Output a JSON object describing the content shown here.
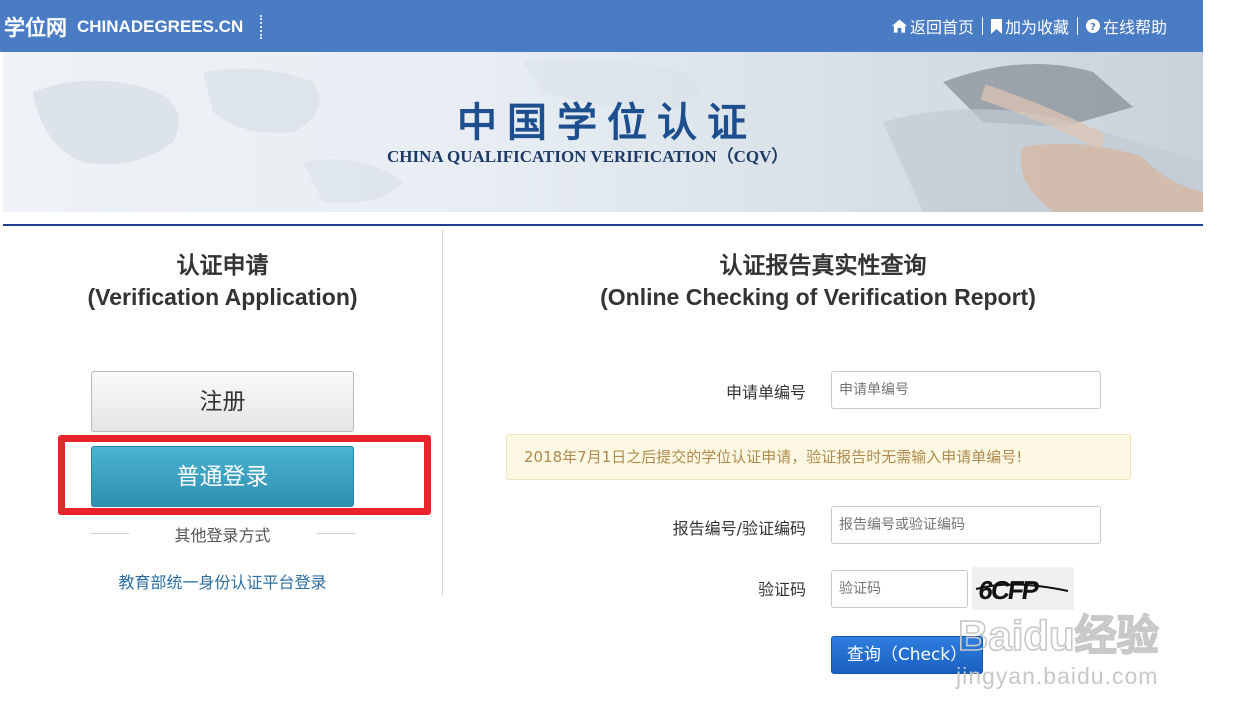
{
  "header": {
    "logo_cn": "学位网",
    "logo_en": "CHINADEGREES.CN",
    "links": [
      {
        "label": "返回首页",
        "icon": "home-icon"
      },
      {
        "label": "加为收藏",
        "icon": "bookmark-icon"
      },
      {
        "label": "在线帮助",
        "icon": "help-icon"
      }
    ]
  },
  "banner": {
    "title": "中国学位认证",
    "subtitle": "CHINA QUALIFICATION VERIFICATION（CQV）"
  },
  "left_panel": {
    "title_cn": "认证申请",
    "title_en": "(Verification Application)",
    "register_label": "注册",
    "login_label": "普通登录",
    "other_login_label": "其他登录方式",
    "edu_login_link": "教育部统一身份认证平台登录"
  },
  "right_panel": {
    "title_cn": "认证报告真实性查询",
    "title_en": "(Online Checking of Verification Report)",
    "application_no_label": "申请单编号",
    "application_no_placeholder": "申请单编号",
    "notice": "2018年7月1日之后提交的学位认证申请，验证报告时无需输入申请单编号!",
    "report_no_label": "报告编号/验证编码",
    "report_no_placeholder": "报告编号或验证编码",
    "captcha_label": "验证码",
    "captcha_placeholder": "验证码",
    "captcha_text": "6CFP",
    "check_button": "查询（Check）"
  },
  "watermark": {
    "brand": "Baidu经验",
    "url": "jingyan.baidu.com"
  },
  "colors": {
    "nav_bg": "#4a7cc5",
    "login_button": "#3aa0c2",
    "check_button": "#1f6bd0",
    "highlight_box": "#e9232b",
    "notice_bg": "#fcf8e3"
  }
}
